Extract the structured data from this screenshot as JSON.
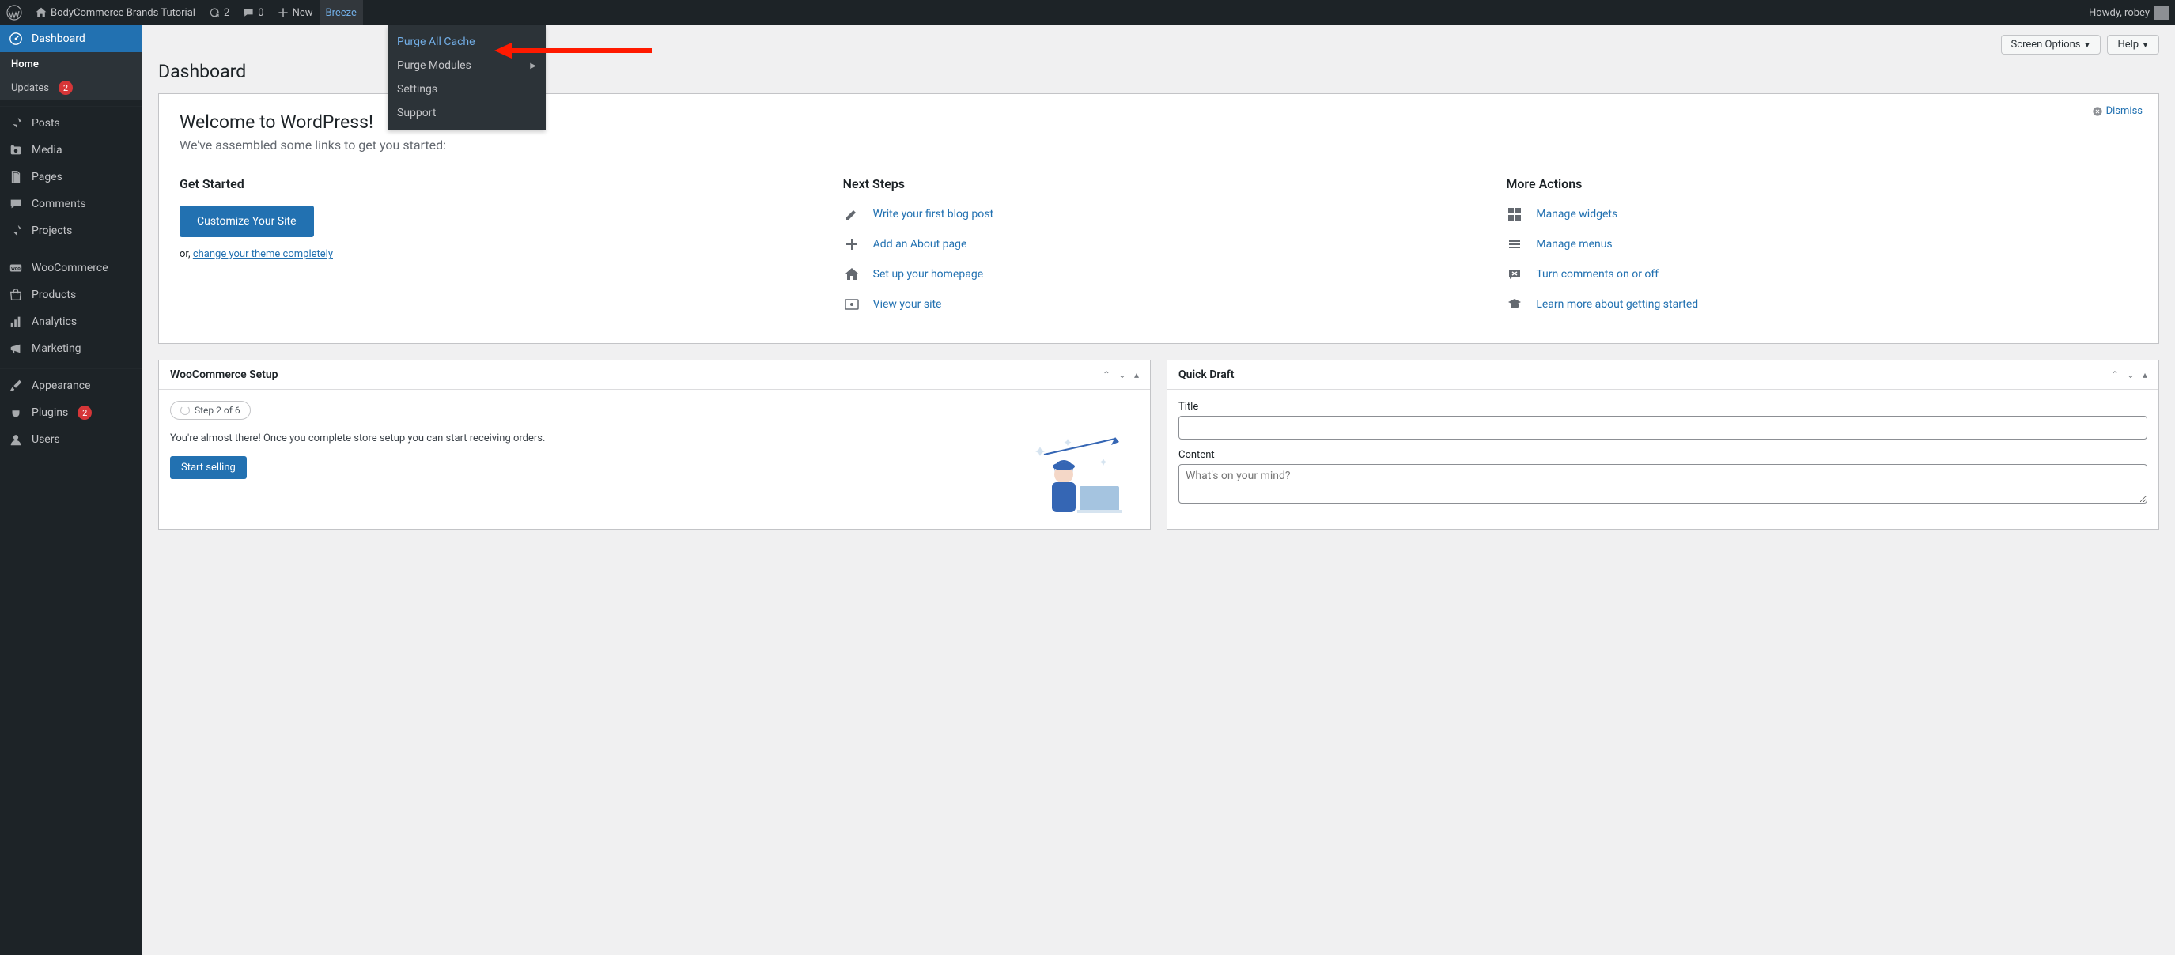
{
  "adminbar": {
    "site_name": "BodyCommerce Brands Tutorial",
    "refresh_count": "2",
    "comments_count": "0",
    "new_label": "New",
    "breeze_label": "Breeze",
    "howdy": "Howdy, robey"
  },
  "breeze_menu": {
    "purge_all": "Purge All Cache",
    "purge_modules": "Purge Modules",
    "settings": "Settings",
    "support": "Support"
  },
  "sidebar": {
    "dashboard": "Dashboard",
    "home": "Home",
    "updates": "Updates",
    "updates_badge": "2",
    "posts": "Posts",
    "media": "Media",
    "pages": "Pages",
    "comments": "Comments",
    "projects": "Projects",
    "woocommerce": "WooCommerce",
    "products": "Products",
    "analytics": "Analytics",
    "marketing": "Marketing",
    "appearance": "Appearance",
    "plugins": "Plugins",
    "plugins_badge": "2",
    "users": "Users"
  },
  "page": {
    "title": "Dashboard",
    "screen_options": "Screen Options",
    "help": "Help"
  },
  "welcome": {
    "heading": "Welcome to WordPress!",
    "sub": "We've assembled some links to get you started:",
    "dismiss": "Dismiss",
    "get_started": "Get Started",
    "customize_btn": "Customize Your Site",
    "or_prefix": "or, ",
    "change_theme": "change your theme completely",
    "next_steps": "Next Steps",
    "links": {
      "write_post": "Write your first blog post",
      "add_about": "Add an About page",
      "setup_home": "Set up your homepage",
      "view_site": "View your site"
    },
    "more_actions": "More Actions",
    "more": {
      "widgets": "Manage widgets",
      "menus": "Manage menus",
      "comments": "Turn comments on or off",
      "learn": "Learn more about getting started"
    }
  },
  "woo": {
    "title": "WooCommerce Setup",
    "step": "Step 2 of 6",
    "desc": "You're almost there! Once you complete store setup you can start receiving orders.",
    "button": "Start selling"
  },
  "quickdraft": {
    "title": "Quick Draft",
    "title_label": "Title",
    "content_label": "Content",
    "content_placeholder": "What's on your mind?"
  }
}
